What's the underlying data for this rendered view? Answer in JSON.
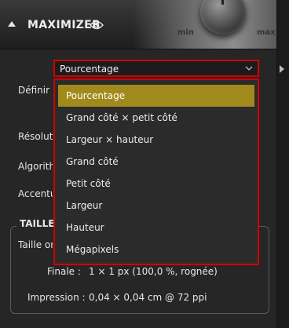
{
  "header": {
    "title": "MAXIMIZER",
    "knob_min": "min",
    "knob_max": "max"
  },
  "form": {
    "definir_label": "Définir",
    "resolution_label": "Résolution",
    "algorithme_label": "Algorithme",
    "accentuation_label": "Accentuation",
    "select_value": "Pourcentage"
  },
  "dropdown": {
    "items": [
      "Pourcentage",
      "Grand côté × petit côté",
      "Largeur × hauteur",
      "Grand côté",
      "Petit côté",
      "Largeur",
      "Hauteur",
      "Mégapixels"
    ],
    "selected": "Pourcentage"
  },
  "taille": {
    "section_title": "TAILLE",
    "originale_label": "Taille originale",
    "finale_label": "Finale :",
    "finale_value": "1 × 1 px (100,0 %, rognée)",
    "impression_label": "Impression :",
    "impression_value": "0,04 × 0,04 cm @ 72 ppi"
  },
  "colors": {
    "accent": "#a18a1c",
    "highlight_border": "#d00000"
  }
}
